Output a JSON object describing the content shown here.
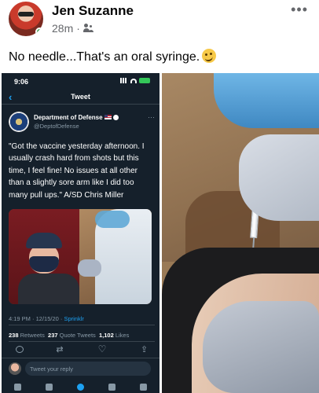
{
  "post": {
    "author": "Jen Suzanne",
    "time": "28m",
    "separator": "·",
    "more": "•••",
    "caption": "No needle...That's an oral syringe."
  },
  "tweet_screenshot": {
    "status_time": "9:06",
    "nav_back": "‹",
    "nav_title": "Tweet",
    "author_name": "Department of Defense",
    "author_handle": "@DeptofDefense",
    "more": "···",
    "text": "\"Got the vaccine yesterday afternoon. I usually crash hard from shots but this time, I feel fine! No issues at all other than a slightly sore arm like I did too many pull ups.\" A/SD Chris Miller",
    "timestamp": "4:19 PM · 12/15/20 · ",
    "source": "Sprinklr",
    "retweets_count": "238",
    "retweets_label": "Retweets",
    "quotes_count": "237",
    "quotes_label": "Quote Tweets",
    "likes_count": "1,102",
    "likes_label": "Likes",
    "reply_placeholder": "Tweet your reply"
  }
}
